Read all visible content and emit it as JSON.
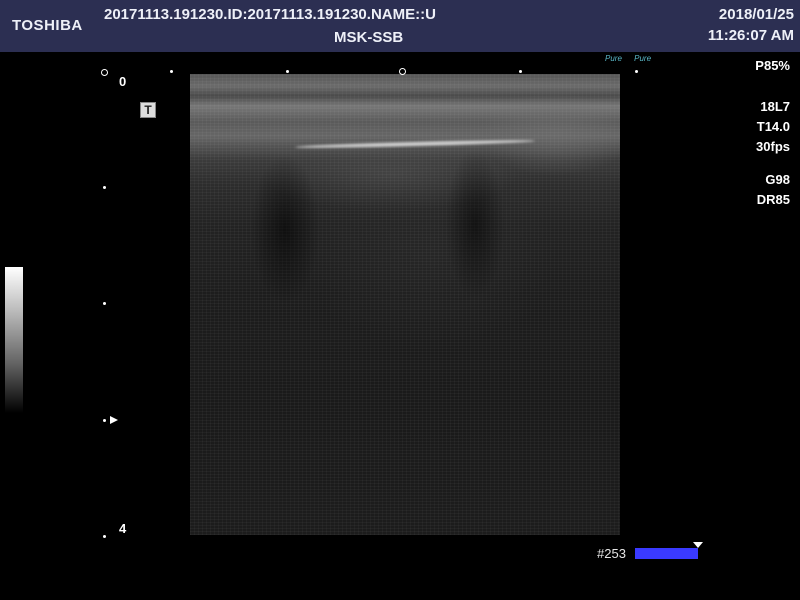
{
  "header": {
    "brand": "TOSHIBA",
    "study_line": "20171113.191230.ID:20171113.191230.NAME::U",
    "preset": "MSK-SSB",
    "date": "2018/01/25",
    "time": "11:26:07 AM"
  },
  "params": {
    "power": "P85%",
    "probe": "18L7",
    "thi": "T14.0",
    "fps": "30fps",
    "gain": "G98",
    "dynamic_range": "DR85"
  },
  "depth": {
    "top_label": "0",
    "bottom_label": "4"
  },
  "overlay": {
    "t_icon": "T",
    "pure_logo_1": "Pure",
    "pure_logo_2": "Pure"
  },
  "footer": {
    "frame_label": "#253"
  },
  "colors": {
    "header_bg": "#2c2f52",
    "frame_bar": "#3a3aff",
    "logo_accent": "#5ab8c8"
  }
}
